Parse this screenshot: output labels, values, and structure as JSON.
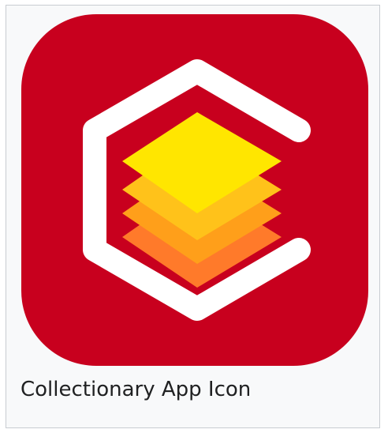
{
  "figure": {
    "caption": "Collectionary App Icon",
    "icon": "collectionary-app-icon",
    "colors": {
      "tile": "#c8001e",
      "outline": "#ffffff",
      "layer_top": "#ffe600",
      "layer_2": "#ffc21a",
      "layer_3": "#ff9f1a",
      "layer_4": "#ff7a2a"
    }
  }
}
